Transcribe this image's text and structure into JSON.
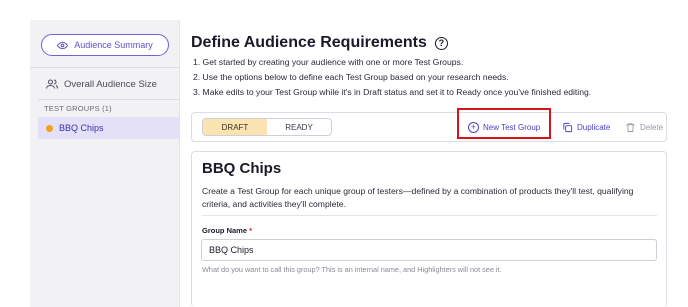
{
  "sidebar": {
    "summary_button": "Audience Summary",
    "overall_audience": "Overall Audience Size",
    "test_groups_heading": "TEST GROUPS (1)",
    "test_groups": [
      {
        "label": "BBQ Chips",
        "status_color": "#f2a21e"
      }
    ]
  },
  "header": {
    "title": "Define Audience Requirements",
    "steps": [
      "1. Get started by creating your audience with one or more Test Groups.",
      "2. Use the options below to define each Test Group based on your research needs.",
      "3. Make edits to your Test Group while it's in Draft status and set it to Ready once you've finished editing."
    ]
  },
  "toolbar": {
    "status_options": [
      "DRAFT",
      "READY"
    ],
    "selected_status": "DRAFT",
    "new_test_group": "New Test Group",
    "duplicate": "Duplicate",
    "delete": "Delete"
  },
  "group_card": {
    "title": "BBQ Chips",
    "description": "Create a Test Group for each unique group of testers—defined by a combination of products they'll test, qualifying criteria, and activities they'll complete.",
    "name_label": "Group Name",
    "name_required_mark": "*",
    "name_value": "BBQ Chips",
    "name_help": "What do you want to call this group? This is an internal name, and Highlighters will not see it."
  },
  "colors": {
    "accent": "#5b51c9",
    "highlight": "#d6141c",
    "draft_active": "#fbe3b2",
    "sidebar_active": "#e3e0f8"
  }
}
